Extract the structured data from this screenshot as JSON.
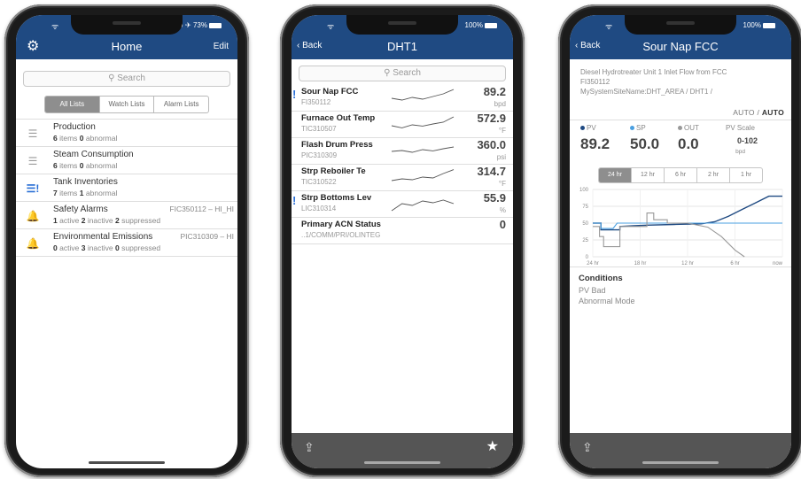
{
  "status_bar": {
    "phone1_right": "⊙ ✈ 73%",
    "phone2_right": "100%",
    "phone3_right": "100%"
  },
  "home_screen": {
    "title": "Home",
    "edit_label": "Edit",
    "search_placeholder": "Search",
    "segments": [
      "All Lists",
      "Watch Lists",
      "Alarm Lists"
    ],
    "rows": [
      {
        "icon": "list-icon",
        "title": "Production",
        "count1": "6",
        "label1": "items",
        "count2": "0",
        "label2": "abnormal",
        "count3": "",
        "label3": "",
        "tag": ""
      },
      {
        "icon": "list-icon",
        "title": "Steam Consumption",
        "count1": "6",
        "label1": "items",
        "count2": "0",
        "label2": "abnormal",
        "count3": "",
        "label3": "",
        "tag": ""
      },
      {
        "icon": "list-alert-icon",
        "title": "Tank Inventories",
        "count1": "7",
        "label1": "items",
        "count2": "1",
        "label2": "abnormal",
        "count3": "",
        "label3": "",
        "tag": ""
      },
      {
        "icon": "bell-red-icon",
        "title": "Safety Alarms",
        "count1": "1",
        "label1": "active",
        "count2": "2",
        "label2": "inactive",
        "count3": "2",
        "label3": "suppressed",
        "tag": "FIC350112 – HI_HI"
      },
      {
        "icon": "bell-yellow-icon",
        "title": "Environmental Emissions",
        "count1": "0",
        "label1": "active",
        "count2": "3",
        "label2": "inactive",
        "count3": "0",
        "label3": "suppressed",
        "tag": "PIC310309 – HI"
      }
    ]
  },
  "list_screen": {
    "back_label": "Back",
    "title": "DHT1",
    "search_placeholder": "Search",
    "rows": [
      {
        "alert": "!",
        "name": "Sour Nap FCC",
        "tag": "FI350112",
        "value": "89.2",
        "unit": "bpd",
        "spark": [
          0.55,
          0.65,
          0.5,
          0.6,
          0.45,
          0.3,
          0.05
        ]
      },
      {
        "alert": "",
        "name": "Furnace Out Temp",
        "tag": "TIC310507",
        "value": "572.9",
        "unit": "°F",
        "spark": [
          0.6,
          0.72,
          0.55,
          0.62,
          0.5,
          0.4,
          0.1
        ]
      },
      {
        "alert": "",
        "name": "Flash Drum Press",
        "tag": "PIC310309",
        "value": "360.0",
        "unit": "psi",
        "spark": [
          0.55,
          0.5,
          0.6,
          0.45,
          0.52,
          0.4,
          0.3
        ]
      },
      {
        "alert": "",
        "name": "Strp Reboiler Te",
        "tag": "TIC310522",
        "value": "314.7",
        "unit": "°F",
        "spark": [
          0.7,
          0.6,
          0.65,
          0.5,
          0.55,
          0.3,
          0.08
        ]
      },
      {
        "alert": "!",
        "name": "Strp Bottoms Lev",
        "tag": "LIC310314",
        "value": "55.9",
        "unit": "%",
        "spark": [
          0.9,
          0.5,
          0.6,
          0.35,
          0.45,
          0.3,
          0.5
        ]
      },
      {
        "alert": "",
        "name": "Primary ACN Status",
        "tag": "..1/COMM/PRI/OLINTEG",
        "value": "0",
        "unit": "",
        "spark": []
      }
    ]
  },
  "detail_screen": {
    "back_label": "Back",
    "title": "Sour Nap FCC",
    "description": "Diesel Hydrotreater Unit 1 Inlet Flow from FCC",
    "tag": "FI350112",
    "path": "MySystemSiteName:DHT_AREA / DHT1 /",
    "mode_left": "AUTO",
    "mode_sep": " / ",
    "mode_right": "AUTO",
    "pv_label": "PV",
    "sp_label": "SP",
    "out_label": "OUT",
    "scale_label": "PV Scale",
    "pv_value": "89.2",
    "sp_value": "50.0",
    "out_value": "0.0",
    "scale_value": "0-102",
    "scale_unit": "bpd",
    "ranges": [
      "24 hr",
      "12 hr",
      "6 hr",
      "2 hr",
      "1 hr"
    ],
    "conditions_title": "Conditions",
    "conditions": [
      "PV Bad",
      "Abnormal Mode"
    ],
    "colors": {
      "pv": "#1f4a82",
      "sp": "#4a9fe0",
      "out": "#999999"
    }
  },
  "chart_data": {
    "type": "line",
    "title": "",
    "x_tick_labels": [
      "24 hr",
      "18 hr",
      "12 hr",
      "6 hr",
      "now"
    ],
    "y_tick_labels": [
      "0",
      "25",
      "50",
      "75",
      "100"
    ],
    "ylim": [
      0,
      100
    ],
    "grid": true,
    "series": [
      {
        "name": "PV",
        "color": "#1f4a82",
        "points": [
          [
            0,
            50
          ],
          [
            0.6,
            50
          ],
          [
            0.6,
            40
          ],
          [
            1.5,
            40
          ],
          [
            2,
            40
          ],
          [
            2,
            45
          ],
          [
            3,
            46
          ],
          [
            4,
            47
          ],
          [
            6,
            48
          ],
          [
            8,
            49
          ],
          [
            9,
            52
          ],
          [
            10,
            60
          ],
          [
            11,
            70
          ],
          [
            12,
            80
          ],
          [
            13,
            90
          ],
          [
            14,
            90
          ]
        ]
      },
      {
        "name": "SP",
        "color": "#4a9fe0",
        "points": [
          [
            0,
            50
          ],
          [
            0.6,
            50
          ],
          [
            0.6,
            42
          ],
          [
            1.5,
            42
          ],
          [
            1.8,
            50
          ],
          [
            14,
            50
          ]
        ]
      },
      {
        "name": "OUT",
        "color": "#999999",
        "points": [
          [
            0,
            45
          ],
          [
            0.5,
            45
          ],
          [
            0.5,
            30
          ],
          [
            0.8,
            30
          ],
          [
            0.8,
            15
          ],
          [
            2,
            15
          ],
          [
            2,
            45
          ],
          [
            4,
            45
          ],
          [
            4,
            65
          ],
          [
            4.5,
            65
          ],
          [
            4.5,
            55
          ],
          [
            5.5,
            55
          ],
          [
            5.5,
            50
          ],
          [
            7,
            50
          ],
          [
            8.5,
            44
          ],
          [
            9.5,
            30
          ],
          [
            10.5,
            10
          ],
          [
            11.2,
            0
          ]
        ]
      }
    ]
  }
}
